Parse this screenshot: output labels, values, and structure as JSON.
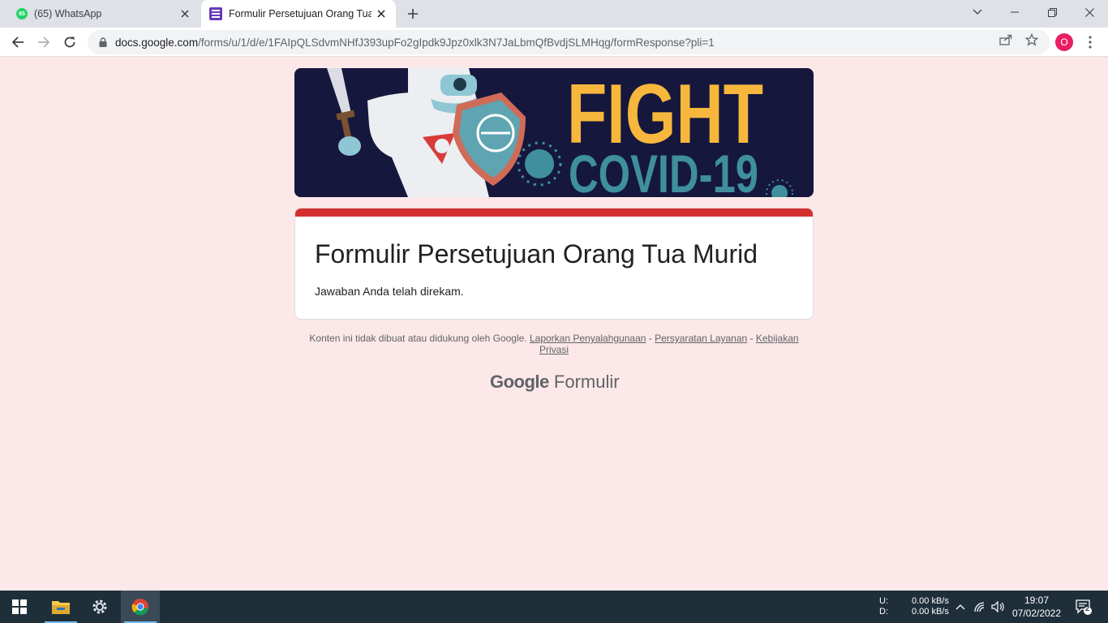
{
  "tabs": [
    {
      "badge": "65",
      "title": "(65) WhatsApp"
    },
    {
      "title": "Formulir Persetujuan Orang Tua Murid"
    }
  ],
  "address_bar": {
    "host": "docs.google.com",
    "path": "/forms/u/1/d/e/1FAIpQLSdvmNHfJ393upFo2gIpdk9Jpz0xlk3N7JaLbmQfBvdjSLMHqg/formResponse?pli=1"
  },
  "profile_initial": "O",
  "banner": {
    "line1": "FIGHT",
    "line2": "COVID-19"
  },
  "form": {
    "title": "Formulir Persetujuan Orang Tua Murid",
    "confirmation": "Jawaban Anda telah direkam."
  },
  "footer": {
    "disclaimer": "Konten ini tidak dibuat atau didukung oleh Google.",
    "link_report": "Laporkan Penyalahgunaan",
    "link_terms": "Persyaratan Layanan",
    "link_privacy": "Kebijakan Privasi",
    "separator": " - "
  },
  "brand": {
    "google": "Google",
    "product": "Formulir"
  },
  "taskbar": {
    "net_up_label": "U:",
    "net_down_label": "D:",
    "net_up_value": "0.00 kB/s",
    "net_down_value": "0.00 kB/s",
    "time": "19:07",
    "date": "07/02/2022",
    "notification_count": "2"
  },
  "colors": {
    "form_accent": "#d32f2f",
    "page_background": "#fce8e8",
    "banner_background": "#15173d",
    "banner_fight": "#f6b73c",
    "banner_covid": "#3f8f9c"
  }
}
